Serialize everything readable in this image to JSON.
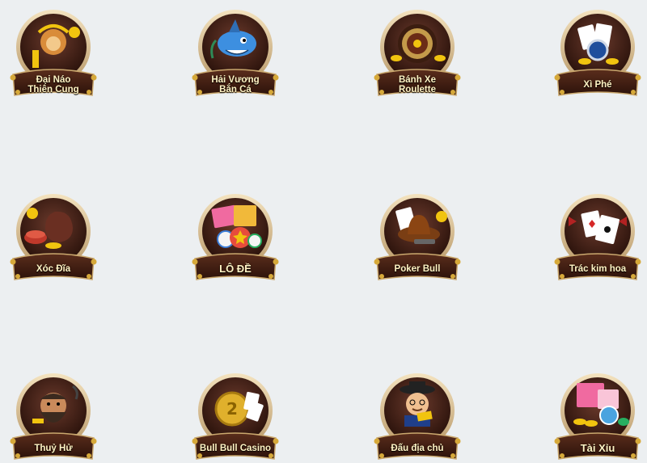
{
  "games": [
    {
      "label": "Đại Náo\nThiên Cung",
      "icon": "monkey-king-icon",
      "accent": "#c0392b"
    },
    {
      "label": "Hải Vương\nBắn Cá",
      "icon": "shark-icon",
      "accent": "#2e86de"
    },
    {
      "label": "Bánh Xe\nRoulette",
      "icon": "roulette-wheel-icon",
      "accent": "#8e3b1f"
    },
    {
      "label": "Xì Phé",
      "icon": "playing-cards-icon",
      "accent": "#1f4e9c"
    },
    {
      "label": "Xóc Đĩa",
      "icon": "dice-bowl-icon",
      "accent": "#7a2a1a"
    },
    {
      "label": "LÔ ĐỀ",
      "icon": "bingo-balls-icon",
      "accent": "#e74c3c"
    },
    {
      "label": "Poker Bull",
      "icon": "cowboy-hat-icon",
      "accent": "#8b4513"
    },
    {
      "label": "Trác kim hoa",
      "icon": "cards-spade-icon",
      "accent": "#b22222"
    },
    {
      "label": "Thuỷ Hử",
      "icon": "warrior-icon",
      "accent": "#5a3a2a"
    },
    {
      "label": "Bull Bull Casino",
      "icon": "gold-coin-icon",
      "accent": "#d4a017"
    },
    {
      "label": "Đấu địa chủ",
      "icon": "landlord-icon",
      "accent": "#8b0000"
    },
    {
      "label": "Tài Xỉu",
      "icon": "bingo-coins-icon",
      "accent": "#c0392b"
    }
  ]
}
